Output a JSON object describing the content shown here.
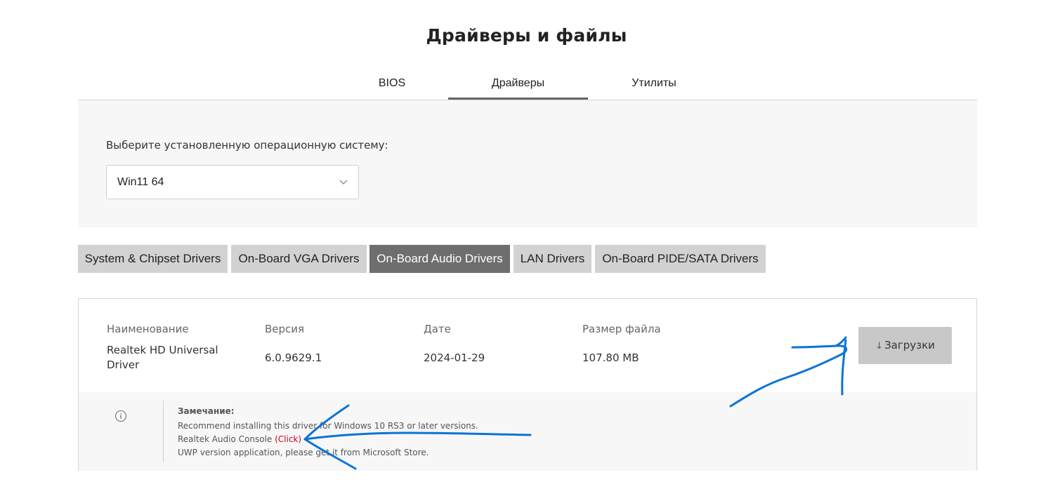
{
  "page": {
    "title": "Драйверы и файлы"
  },
  "tabs": [
    {
      "label": "BIOS",
      "active": false
    },
    {
      "label": "Драйверы",
      "active": true
    },
    {
      "label": "Утилиты",
      "active": false
    }
  ],
  "os_select": {
    "label": "Выберите установленную операционную систему:",
    "value": "Win11 64",
    "icon": "chevron-down-icon"
  },
  "categories": [
    {
      "label": "System & Chipset Drivers",
      "active": false
    },
    {
      "label": "On-Board VGA Drivers",
      "active": false
    },
    {
      "label": "On-Board Audio Drivers",
      "active": true
    },
    {
      "label": "LAN Drivers",
      "active": false
    },
    {
      "label": "On-Board PIDE/SATA Drivers",
      "active": false
    }
  ],
  "driver": {
    "headers": {
      "name": "Наименование",
      "version": "Версия",
      "date": "Дате",
      "size": "Размер файла"
    },
    "name": "Realtek HD Universal Driver",
    "name_line1": "Realtek HD Universal",
    "name_line2": "Driver",
    "version": "6.0.9629.1",
    "date": "2024-01-29",
    "size": "107.80 MB",
    "download_label": "Загрузки",
    "download_icon": "download-arrow-icon"
  },
  "note": {
    "icon": "info-icon",
    "title": "Замечание:",
    "line1": "Recommend installing this driver for Windows 10 RS3 or later versions.",
    "line2_text": "Realtek Audio Console",
    "line2_link": "(Click)",
    "line3": "UWP version application, please get it from Microsoft Store."
  },
  "colors": {
    "active_category_bg": "#6e6e6e",
    "category_bg": "#d2d2d2",
    "panel_bg": "#f7f7f7",
    "link_red": "#d0021b",
    "annotation_blue": "#0a74d6"
  }
}
